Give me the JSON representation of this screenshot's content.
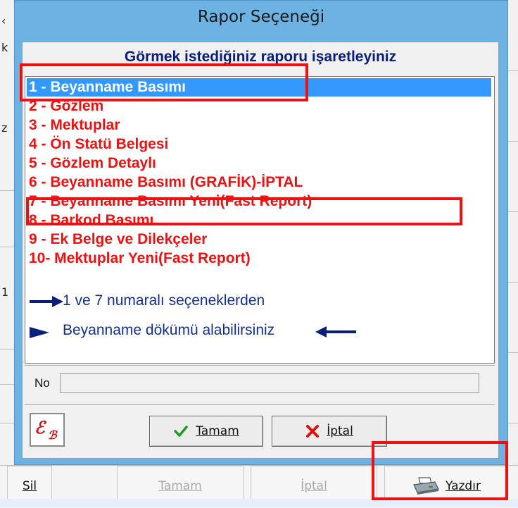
{
  "dialog": {
    "title": "Rapor Seçeneği",
    "heading": "Görmek istediğiniz raporu işaretleyiniz",
    "items": [
      "1 - Beyanname Basımı",
      "2 - Gözlem",
      "3 - Mektuplar",
      "4 - Ön Statü Belgesi",
      "5 - Gözlem Detaylı",
      "6 - Beyanname Basımı (GRAFİK)-İPTAL",
      "7 - Beyanname Basımı Yeni(Fast Report)",
      "8 - Barkod    Basımı",
      "9 - Ek Belge ve Dilekçeler",
      "10- Mektuplar Yeni(Fast Report)"
    ],
    "selected_index": 0,
    "note_line1": "1 ve 7 numaralı seçeneklerden",
    "note_line2": "Beyanname dökümü alabilirsiniz",
    "no_label": "No",
    "no_value": "",
    "ok_label": "Tamam",
    "cancel_label": "İptal",
    "logo_text": "EB"
  },
  "toolbar": {
    "sil_label": "Sil",
    "tamam_label": "Tamam",
    "iptal_label": "İptal",
    "yazdir_label": "Yazdır"
  },
  "colors": {
    "title_bar": "#6cb2e3",
    "selection": "#3399ff",
    "item_text": "#ee1111",
    "heading_text": "#0b1f7a",
    "annotation": "#ee1111"
  },
  "icons": {
    "ok": "checkmark-icon",
    "cancel": "x-icon",
    "print": "printer-icon",
    "arrow": "arrow-icon"
  }
}
